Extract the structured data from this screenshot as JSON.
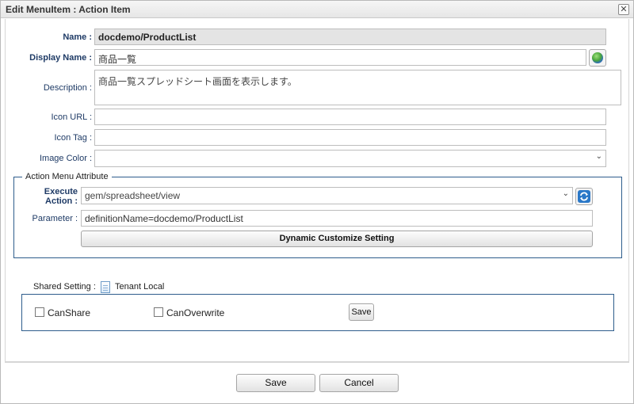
{
  "dialog": {
    "title": "Edit MenuItem : Action Item"
  },
  "form": {
    "name_label": "Name :",
    "name_value": "docdemo/ProductList",
    "display_name_label": "Display Name :",
    "display_name_value": "商品一覧",
    "description_label": "Description :",
    "description_value": "商品一覧スプレッドシート画面を表示します。",
    "icon_url_label": "Icon URL :",
    "icon_url_value": "",
    "icon_tag_label": "Icon Tag :",
    "icon_tag_value": "",
    "image_color_label": "Image Color :",
    "image_color_value": ""
  },
  "action_menu": {
    "legend": "Action Menu Attribute",
    "execute_label_line1": "Execute",
    "execute_label_line2": "Action :",
    "execute_value": "gem/spreadsheet/view",
    "parameter_label": "Parameter :",
    "parameter_value": "definitionName=docdemo/ProductList",
    "dynamic_button": "Dynamic Customize Setting"
  },
  "shared": {
    "label": "Shared Setting :",
    "scope": "Tenant Local",
    "can_share_label": "CanShare",
    "can_share_checked": false,
    "can_overwrite_label": "CanOverwrite",
    "can_overwrite_checked": false,
    "save_label": "Save"
  },
  "footer": {
    "save_label": "Save",
    "cancel_label": "Cancel"
  },
  "icons": {
    "close": "close-icon",
    "globe": "globe-icon",
    "refresh": "refresh-icon",
    "document": "document-icon",
    "dropdown": "chevron-down-icon"
  }
}
